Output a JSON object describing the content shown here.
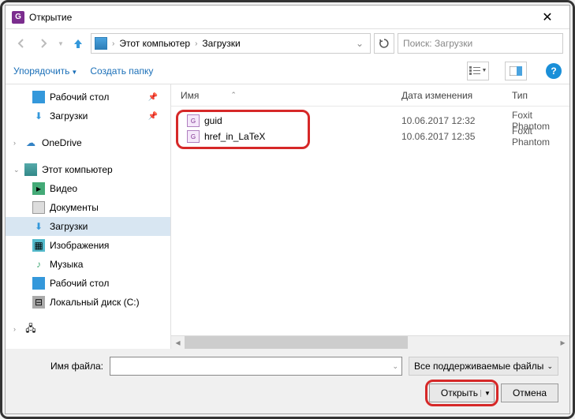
{
  "title": "Открытие",
  "breadcrumb": {
    "root": "Этот компьютер",
    "folder": "Загрузки"
  },
  "search_placeholder": "Поиск: Загрузки",
  "toolbar": {
    "organize": "Упорядочить",
    "new_folder": "Создать папку"
  },
  "columns": {
    "name": "Имя",
    "date": "Дата изменения",
    "type": "Тип"
  },
  "sidebar": {
    "desktop": "Рабочий стол",
    "downloads": "Загрузки",
    "onedrive": "OneDrive",
    "this_pc": "Этот компьютер",
    "videos": "Видео",
    "documents": "Документы",
    "pictures": "Изображения",
    "music": "Музыка",
    "local_disk": "Локальный диск (C:)"
  },
  "files": [
    {
      "name": "guid",
      "date": "10.06.2017 12:32",
      "type": "Foxit Phantom"
    },
    {
      "name": "href_in_LaTeX",
      "date": "10.06.2017 12:35",
      "type": "Foxit Phantom"
    }
  ],
  "footer": {
    "filename_label": "Имя файла:",
    "filter": "Все поддерживаемые файлы",
    "open": "Открыть",
    "cancel": "Отмена"
  }
}
